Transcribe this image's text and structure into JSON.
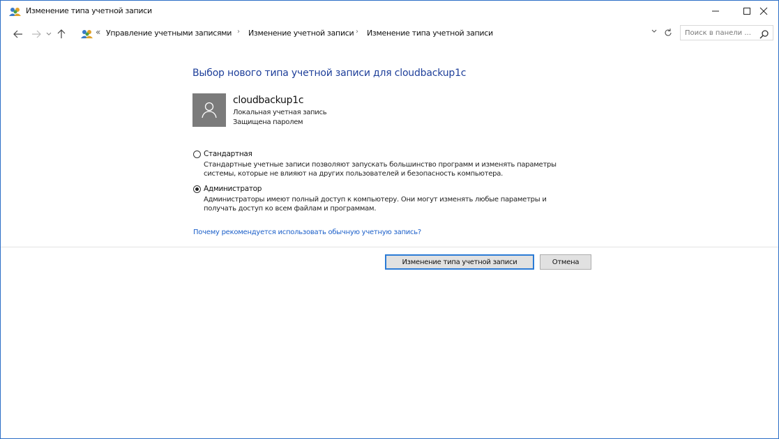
{
  "window": {
    "title": "Изменение типа учетной записи",
    "controls": {
      "minimize": "–",
      "maximize": "☐",
      "close": "✕"
    }
  },
  "navigation": {
    "back_icon": "arrow-left-icon",
    "forward_icon": "arrow-right-icon",
    "recent_icon": "chevron-down-icon",
    "up_icon": "arrow-up-icon",
    "address_prefix": "«",
    "breadcrumbs": [
      "Управление учетными записями",
      "Изменение учетной записи",
      "Изменение типа учетной записи"
    ],
    "separator": "›",
    "search_placeholder": "Поиск в панели ...",
    "search_icon": "search-icon",
    "refresh_icon": "refresh-icon"
  },
  "content": {
    "heading": "Выбор нового типа учетной записи для cloudbackup1c",
    "account": {
      "name": "cloudbackup1c",
      "type": "Локальная учетная запись",
      "status": "Защищена паролем",
      "avatar_icon": "user-icon"
    },
    "options": [
      {
        "label": "Стандартная",
        "selected": false,
        "desc_line1": "Стандартные учетные записи позволяют запускать большинство программ и изменять параметры",
        "desc_line2": "системы, которые не влияют на других пользователей и безопасность компьютера."
      },
      {
        "label": "Администратор",
        "selected": true,
        "desc_line1": "Администраторы имеют полный доступ к компьютеру. Они могут изменять любые параметры и",
        "desc_line2": "получать доступ ко всем файлам и программам."
      }
    ],
    "help_link": "Почему рекомендуется использовать обычную учетную запись?"
  },
  "buttons": {
    "change": "Изменение типа учетной записи",
    "cancel": "Отмена"
  },
  "colors": {
    "heading": "#1e3f9a",
    "link": "#1b5fc9",
    "window_border": "#2b6ec7",
    "avatar_bg": "#7b7b7b"
  }
}
